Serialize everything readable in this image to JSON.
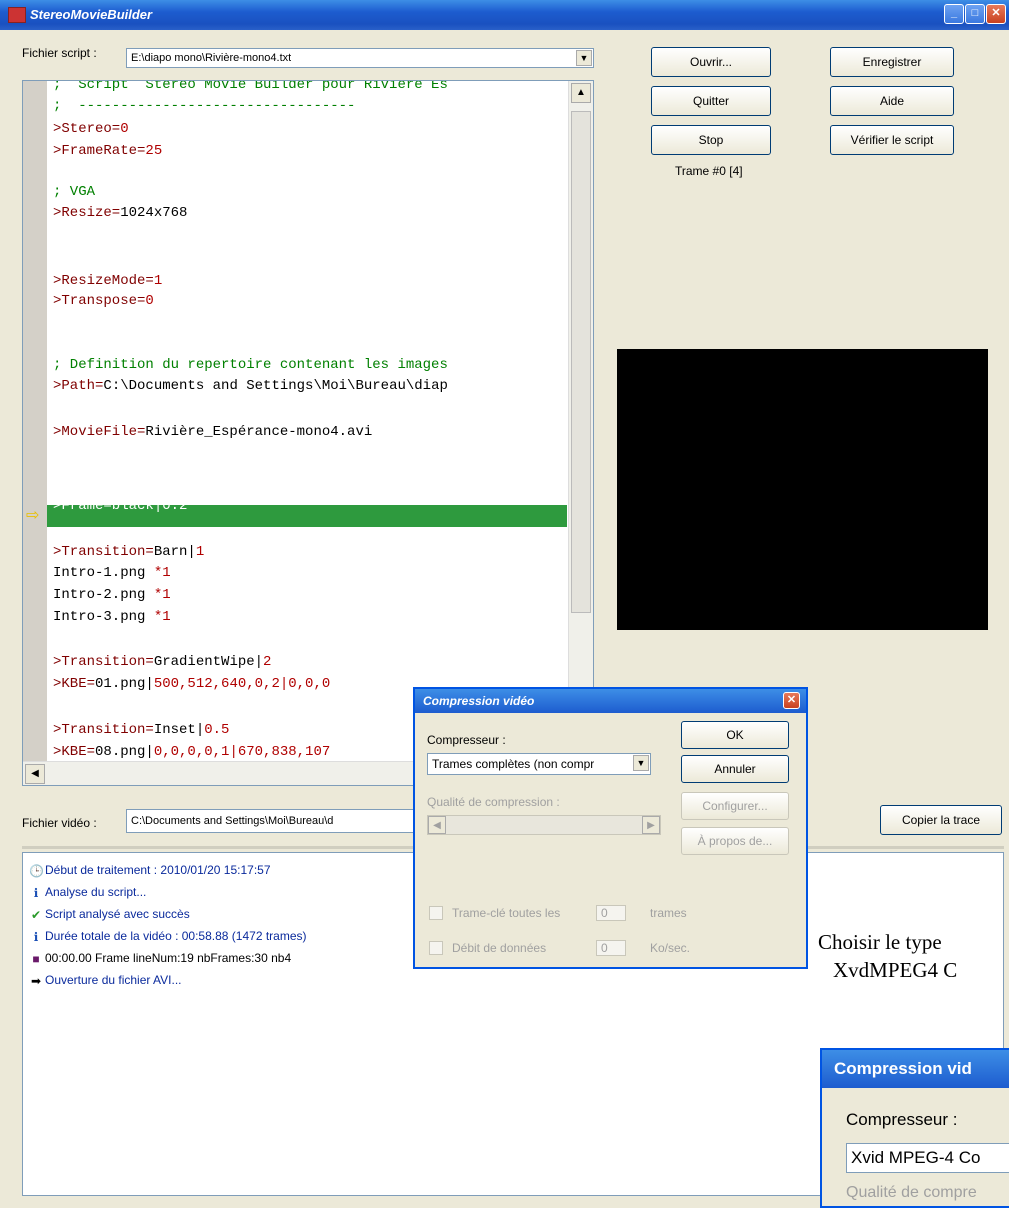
{
  "window": {
    "title": "StereoMovieBuilder"
  },
  "script_file": {
    "label": "Fichier script :",
    "value": "E:\\diapo mono\\Rivière-mono4.txt"
  },
  "buttons": {
    "open": "Ouvrir...",
    "save": "Enregistrer",
    "quit": "Quitter",
    "help": "Aide",
    "stop": "Stop",
    "verify": "Vérifier le script",
    "copy_trace": "Copier la trace"
  },
  "frame_status": "Trame #0 [4]",
  "script_lines": [
    {
      "parts": [
        {
          "t": ";  Script  Stereo Movie Builder pour Rivière Es",
          "c": "c"
        }
      ]
    },
    {
      "parts": [
        {
          "t": ";  ---------------------------------",
          "c": "c"
        }
      ]
    },
    {
      "parts": [
        {
          "t": ">Stereo=",
          "c": "k"
        },
        {
          "t": "0",
          "c": "n"
        }
      ]
    },
    {
      "parts": [
        {
          "t": ">FrameRate=",
          "c": "k"
        },
        {
          "t": "25",
          "c": "n"
        }
      ]
    },
    {
      "parts": [
        {
          "t": "",
          "c": ""
        }
      ]
    },
    {
      "parts": [
        {
          "t": "; VGA",
          "c": "c"
        }
      ]
    },
    {
      "parts": [
        {
          "t": ">Resize=",
          "c": "k"
        },
        {
          "t": "1024x768",
          "c": ""
        }
      ]
    },
    {
      "parts": [
        {
          "t": "",
          "c": ""
        }
      ]
    },
    {
      "parts": [
        {
          "t": "",
          "c": ""
        }
      ]
    },
    {
      "parts": [
        {
          "t": ">ResizeMode=",
          "c": "k"
        },
        {
          "t": "1",
          "c": "n"
        }
      ]
    },
    {
      "parts": [
        {
          "t": ">Transpose=",
          "c": "k"
        },
        {
          "t": "0",
          "c": "n"
        }
      ]
    },
    {
      "parts": [
        {
          "t": "",
          "c": ""
        }
      ]
    },
    {
      "parts": [
        {
          "t": "",
          "c": ""
        }
      ]
    },
    {
      "parts": [
        {
          "t": "; Definition du repertoire contenant les images",
          "c": "c"
        }
      ]
    },
    {
      "parts": [
        {
          "t": ">Path=",
          "c": "k"
        },
        {
          "t": "C:\\Documents and Settings\\Moi\\Bureau\\diap",
          "c": ""
        }
      ]
    },
    {
      "parts": [
        {
          "t": "",
          "c": ""
        }
      ]
    },
    {
      "parts": [
        {
          "t": ">MovieFile=",
          "c": "k"
        },
        {
          "t": "Rivière_Espérance-mono4.avi",
          "c": ""
        }
      ]
    },
    {
      "parts": [
        {
          "t": "",
          "c": ""
        }
      ]
    },
    {
      "parts": [
        {
          "t": "",
          "c": ""
        }
      ]
    },
    {
      "parts": [
        {
          "t": ">Frame=black|0.2",
          "c": "hl"
        }
      ]
    },
    {
      "parts": [
        {
          "t": "",
          "c": ""
        }
      ]
    },
    {
      "parts": [
        {
          "t": ">Transition=",
          "c": "k"
        },
        {
          "t": "Barn|",
          "c": ""
        },
        {
          "t": "1",
          "c": "n"
        }
      ]
    },
    {
      "parts": [
        {
          "t": "Intro-1.png ",
          "c": ""
        },
        {
          "t": "*1",
          "c": "n"
        }
      ]
    },
    {
      "parts": [
        {
          "t": "Intro-2.png ",
          "c": ""
        },
        {
          "t": "*1",
          "c": "n"
        }
      ]
    },
    {
      "parts": [
        {
          "t": "Intro-3.png ",
          "c": ""
        },
        {
          "t": "*1",
          "c": "n"
        }
      ]
    },
    {
      "parts": [
        {
          "t": "",
          "c": ""
        }
      ]
    },
    {
      "parts": [
        {
          "t": ">Transition=",
          "c": "k"
        },
        {
          "t": "GradientWipe|",
          "c": ""
        },
        {
          "t": "2",
          "c": "n"
        }
      ]
    },
    {
      "parts": [
        {
          "t": ">KBE=",
          "c": "k"
        },
        {
          "t": "01.png|",
          "c": ""
        },
        {
          "t": "500,512,640,0,2|0,0,0",
          "c": "n"
        }
      ]
    },
    {
      "parts": [
        {
          "t": "",
          "c": ""
        }
      ]
    },
    {
      "parts": [
        {
          "t": ">Transition=",
          "c": "k"
        },
        {
          "t": "Inset|",
          "c": ""
        },
        {
          "t": "0.5",
          "c": "n"
        }
      ]
    },
    {
      "parts": [
        {
          "t": ">KBE=",
          "c": "k"
        },
        {
          "t": "08.png|",
          "c": ""
        },
        {
          "t": "0,0,0,0,1|670,838,107",
          "c": "n"
        }
      ]
    }
  ],
  "video_file": {
    "label": "Fichier vidéo :",
    "value": "C:\\Documents and Settings\\Moi\\Bureau\\d"
  },
  "log": [
    {
      "icon": "clock-icon",
      "glyph": "🕒",
      "text": "Début de traitement : 2010/01/20 15:17:57"
    },
    {
      "icon": "info-icon",
      "glyph": "ℹ",
      "text": "Analyse du script..."
    },
    {
      "icon": "check-icon",
      "glyph": "✔",
      "text": "Script analysé avec succès"
    },
    {
      "icon": "info-icon",
      "glyph": "ℹ",
      "text": "Durée totale de la vidéo : 00:58.88  (1472 trames)"
    },
    {
      "icon": "frame-icon",
      "glyph": "■",
      "text": "00:00.00  Frame               lineNum:19  nbFrames:30  nb4"
    },
    {
      "icon": "arrow-icon",
      "glyph": "➡",
      "text": "Ouverture du fichier AVI..."
    }
  ],
  "dialog": {
    "title": "Compression vidéo",
    "compressor_label": "Compresseur :",
    "compressor_value": "Trames complètes (non compr",
    "quality_label": "Qualité de compression :",
    "keyframe_label": "Trame-clé toutes les",
    "keyframe_value": "0",
    "keyframe_unit": "trames",
    "datarate_label": "Débit de données",
    "datarate_value": "0",
    "datarate_unit": "Ko/sec.",
    "ok": "OK",
    "cancel": "Annuler",
    "configure": "Configurer...",
    "about": "À propos de..."
  },
  "note": {
    "line1": "Choisir le type",
    "line2": "XvdMPEG4 C"
  },
  "dialog2": {
    "title": "Compression vid",
    "compressor_label": "Compresseur :",
    "compressor_value": "Xvid MPEG-4 Co",
    "quality_label": "Qualité de compre"
  }
}
